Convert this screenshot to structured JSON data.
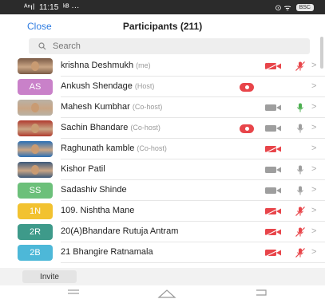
{
  "status_bar": {
    "time": "11:15",
    "signal": "ᴬⁿıl",
    "extras": "ᵏᴮ ···",
    "icons": "⊙ ᯤ",
    "battery": "BSC"
  },
  "header": {
    "close_label": "Close",
    "title": "Participants (211)"
  },
  "search": {
    "placeholder": "Search"
  },
  "participants": [
    {
      "name": "krishna Deshmukh",
      "role": "(me)",
      "avatar": "photo",
      "avatar_color": "#7a5a45",
      "recording": false,
      "video": "off",
      "mic": "off"
    },
    {
      "name": "Ankush Shendage",
      "role": "(Host)",
      "avatar": "AS",
      "avatar_color": "#c981c9",
      "recording": true,
      "video": "none",
      "mic": "none"
    },
    {
      "name": "Mahesh Kumbhar",
      "role": "(Co-host)",
      "avatar": "photo",
      "avatar_color": "#b9b2a5",
      "recording": false,
      "video": "on",
      "mic": "active"
    },
    {
      "name": "Sachin Bhandare",
      "role": "(Co-host)",
      "avatar": "photo",
      "avatar_color": "#b03a2e",
      "recording": true,
      "video": "on",
      "mic": "on"
    },
    {
      "name": "Raghunath kamble",
      "role": "(Co-host)",
      "avatar": "photo",
      "avatar_color": "#2a6fb5",
      "recording": false,
      "video": "off",
      "mic": "none"
    },
    {
      "name": "Kishor Patil",
      "role": "",
      "avatar": "photo",
      "avatar_color": "#3d5a7a",
      "recording": false,
      "video": "on",
      "mic": "on"
    },
    {
      "name": "Sadashiv Shinde",
      "role": "",
      "avatar": "SS",
      "avatar_color": "#6cc07a",
      "recording": false,
      "video": "on",
      "mic": "on"
    },
    {
      "name": "109. Nishtha Mane",
      "role": "",
      "avatar": "1N",
      "avatar_color": "#f2c230",
      "recording": false,
      "video": "off",
      "mic": "off"
    },
    {
      "name": "20(A)Bhandare Rutuja Antram",
      "role": "",
      "avatar": "2R",
      "avatar_color": "#3e9a8a",
      "recording": false,
      "video": "off",
      "mic": "off"
    },
    {
      "name": "21 Bhangire Ratnamala",
      "role": "",
      "avatar": "2B",
      "avatar_color": "#4db8d8",
      "recording": false,
      "video": "off",
      "mic": "off"
    }
  ],
  "footer": {
    "invite_label": "Invite"
  },
  "colors": {
    "accent": "#2d7be0",
    "muted_red": "#e8454a",
    "unmuted_green": "#4caf50",
    "gray_icon": "#9e9e9e"
  }
}
